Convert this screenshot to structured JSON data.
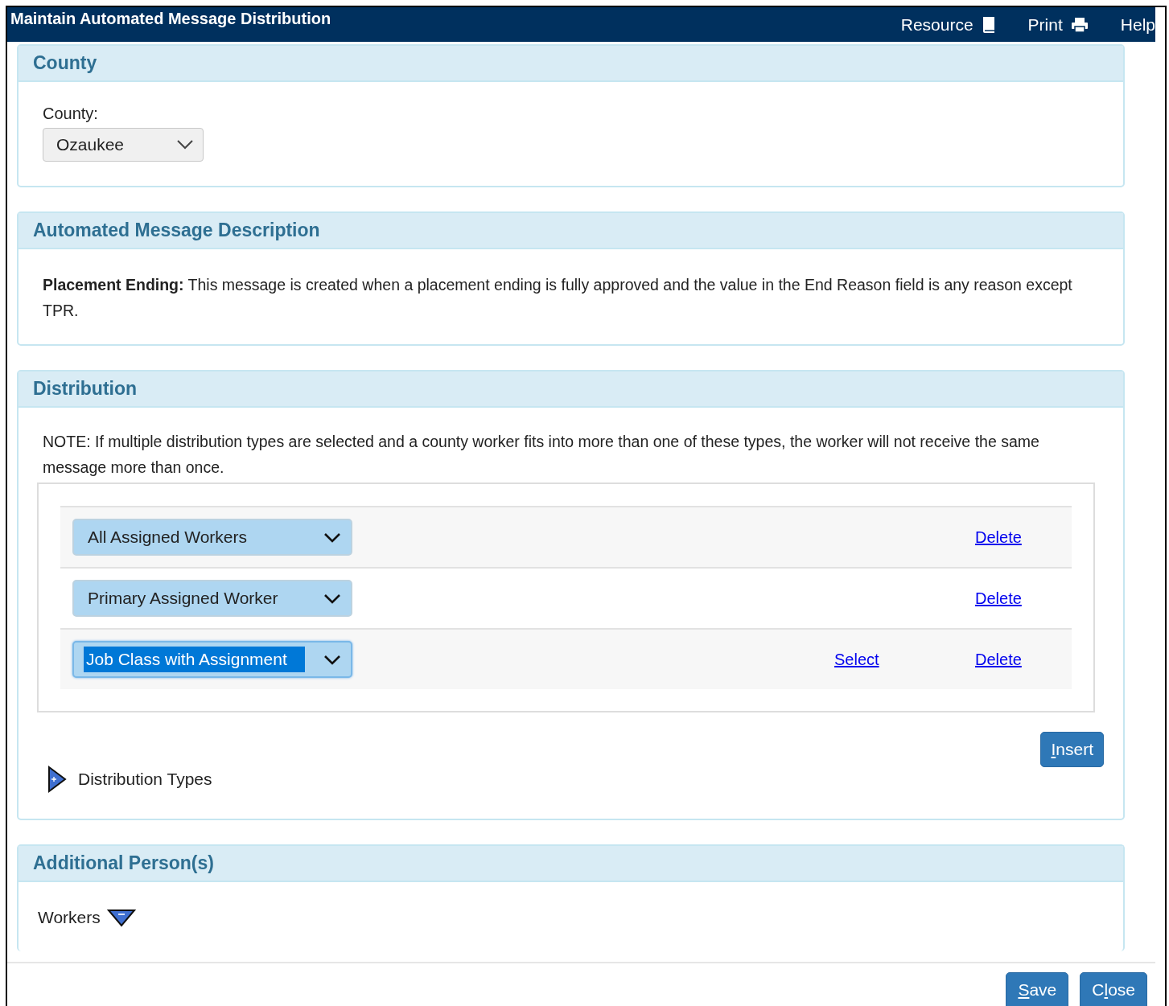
{
  "window": {
    "title": "Maintain Automated Message Distribution"
  },
  "header_links": [
    {
      "label": "Resource",
      "kind": "book"
    },
    {
      "label": "Print",
      "kind": "print"
    },
    {
      "label": "Help",
      "kind": "none"
    }
  ],
  "county": {
    "heading": "County",
    "label": "County:",
    "value": "Ozaukee"
  },
  "description": {
    "heading": "Automated Message Description",
    "lead": "Placement Ending:",
    "text": "This message is created when a placement ending is fully approved and the value in the End Reason field is any reason except TPR."
  },
  "distribution": {
    "heading": "Distribution",
    "note": "NOTE: If multiple distribution types are selected and a county worker fits into more than one of these types, the worker will not receive the same message more than once.",
    "rows": [
      {
        "value": "All Assigned Workers",
        "focused": false,
        "delete": "Delete"
      },
      {
        "value": "Primary Assigned Worker",
        "focused": false,
        "delete": "Delete"
      },
      {
        "value": "Job Class with Assignment",
        "focused": true,
        "select": "Select",
        "delete": "Delete"
      }
    ],
    "insert_button": {
      "access_key": "I",
      "label_rest": "nsert"
    },
    "types_toggle": {
      "label": "Distribution Types",
      "expanded": false
    }
  },
  "additional": {
    "heading": "Additional Person(s)",
    "workers_toggle": {
      "label": "Workers",
      "expanded": true
    }
  },
  "footer_buttons": [
    {
      "access_key": "S",
      "label_rest": "ave"
    },
    {
      "label_start": "C",
      "access_key": "l",
      "label_rest": "ose"
    }
  ]
}
